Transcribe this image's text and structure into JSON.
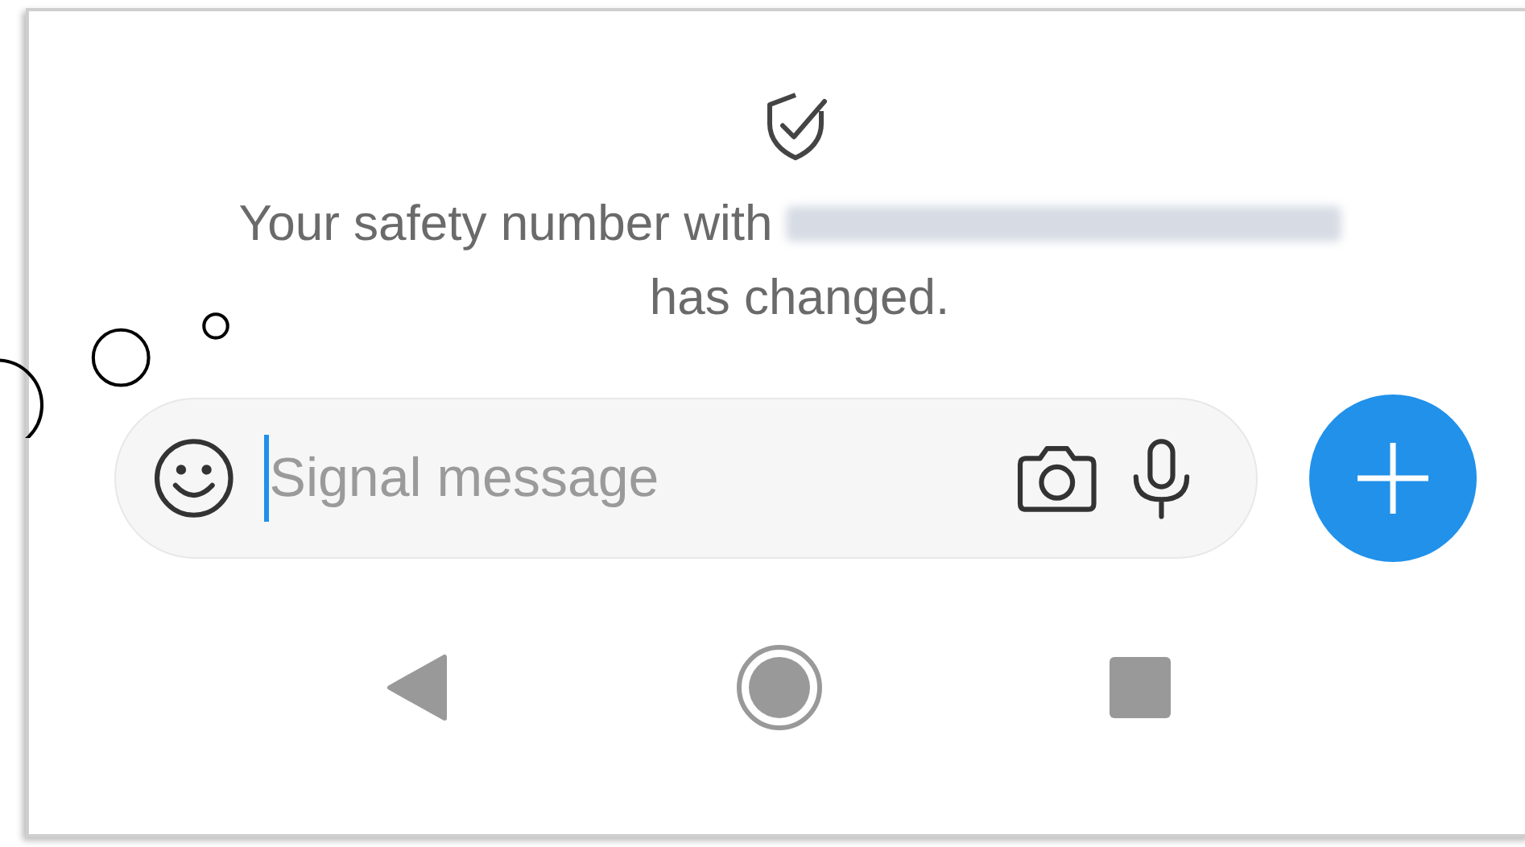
{
  "notice": {
    "text_before_name": "Your safety number with",
    "text_after_name": "has changed."
  },
  "composer": {
    "placeholder": "Signal message"
  }
}
